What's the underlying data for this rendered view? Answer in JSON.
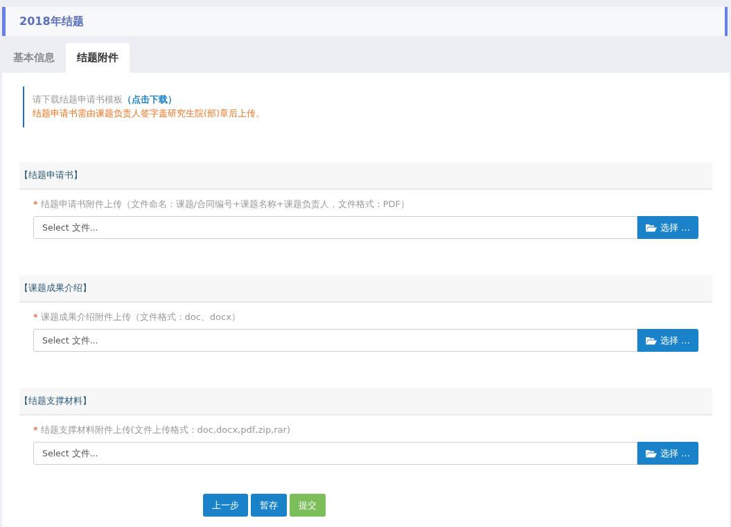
{
  "header": {
    "title": "2018年结题"
  },
  "tabs": [
    {
      "label": "基本信息",
      "selected": false
    },
    {
      "label": "结题附件",
      "selected": true
    }
  ],
  "notice": {
    "text": "请下载结题申请书模板",
    "link": "（点击下载）",
    "warning": "结题申请书需由课题负责人签字盖研究生院(部)章后上传。"
  },
  "sections": [
    {
      "title": "【结题申请书】",
      "required_mark": "*",
      "label": "结题申请书附件上传（文件命名：课题/合同编号+课题名称+课题负责人，文件格式：PDF）",
      "placeholder": "Select 文件...",
      "button": "选择 ..."
    },
    {
      "title": "【课题成果介绍】",
      "required_mark": "*",
      "label": "课题成果介绍附件上传（文件格式：doc、docx）",
      "placeholder": "Select 文件...",
      "button": "选择 ..."
    },
    {
      "title": "【结题支撑材料】",
      "required_mark": "*",
      "label": "结题支撑材料附件上传(文件上传格式：doc,docx,pdf,zip,rar)",
      "placeholder": "Select 文件...",
      "button": "选择 ..."
    }
  ],
  "actions": [
    {
      "label": "上一步",
      "kind": "primary"
    },
    {
      "label": "暂存",
      "kind": "primary"
    },
    {
      "label": "提交",
      "kind": "success"
    }
  ]
}
